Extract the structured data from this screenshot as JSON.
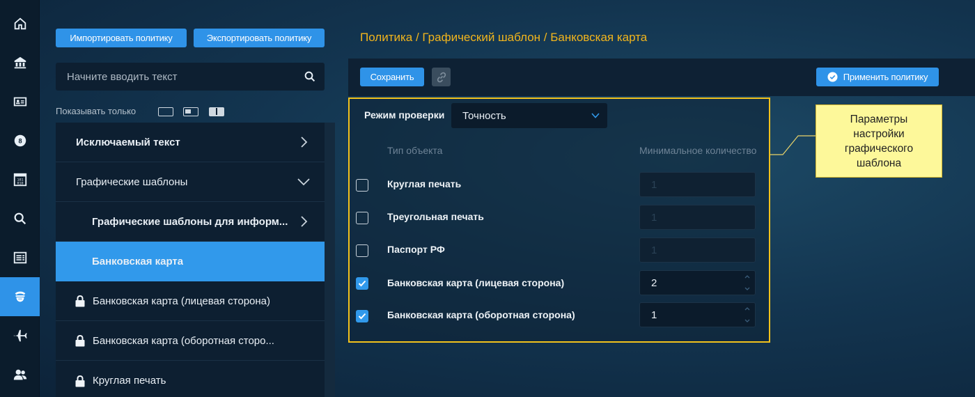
{
  "rail": {
    "items": [
      {
        "icon": "home-icon"
      },
      {
        "icon": "bank-icon"
      },
      {
        "icon": "id-card-icon"
      },
      {
        "icon": "badge-icon"
      },
      {
        "icon": "binary-icon"
      },
      {
        "icon": "search-icon"
      },
      {
        "icon": "list-icon"
      },
      {
        "icon": "policy-icon",
        "active": true
      },
      {
        "icon": "plane-icon"
      },
      {
        "icon": "users-icon"
      }
    ]
  },
  "left_panel": {
    "import_label": "Импортировать политику",
    "export_label": "Экспортировать политику",
    "search_placeholder": "Начните вводить текст",
    "filter_label": "Показывать только",
    "tree": [
      {
        "label": "Исключаемый текст",
        "chevron": "right"
      },
      {
        "label": "Графические шаблоны",
        "chevron": "down"
      },
      {
        "label": "Графические шаблоны для информ...",
        "chevron": "right"
      },
      {
        "label": "Банковская карта",
        "selected": true
      },
      {
        "label": "Банковская карта (лицевая сторона)",
        "locked": true
      },
      {
        "label": "Банковская карта (оборотная сторо...",
        "locked": true
      },
      {
        "label": "Круглая печать",
        "locked": true
      }
    ]
  },
  "breadcrumb": "Политика / Графический шаблон / Банковская карта",
  "toolbar": {
    "save_label": "Сохранить",
    "apply_label": "Применить политику"
  },
  "params": {
    "mode_label": "Режим проверки",
    "mode_value": "Точность",
    "col_type": "Тип объекта",
    "col_min": "Минимальное количество",
    "rows": [
      {
        "label": "Круглая печать",
        "checked": false,
        "qty": "1"
      },
      {
        "label": "Треугольная печать",
        "checked": false,
        "qty": "1"
      },
      {
        "label": "Паспорт РФ",
        "checked": false,
        "qty": "1"
      },
      {
        "label": "Банковская карта (лицевая сторона)",
        "checked": true,
        "qty": "2"
      },
      {
        "label": "Банковская карта (оборотная сторона)",
        "checked": true,
        "qty": "1"
      }
    ]
  },
  "callout": "Параметры\nнастройки\nграфического\nшаблона",
  "colors": {
    "accent": "#3199eb",
    "highlight": "#f2c21c",
    "breadcrumb": "#f2b51c"
  }
}
